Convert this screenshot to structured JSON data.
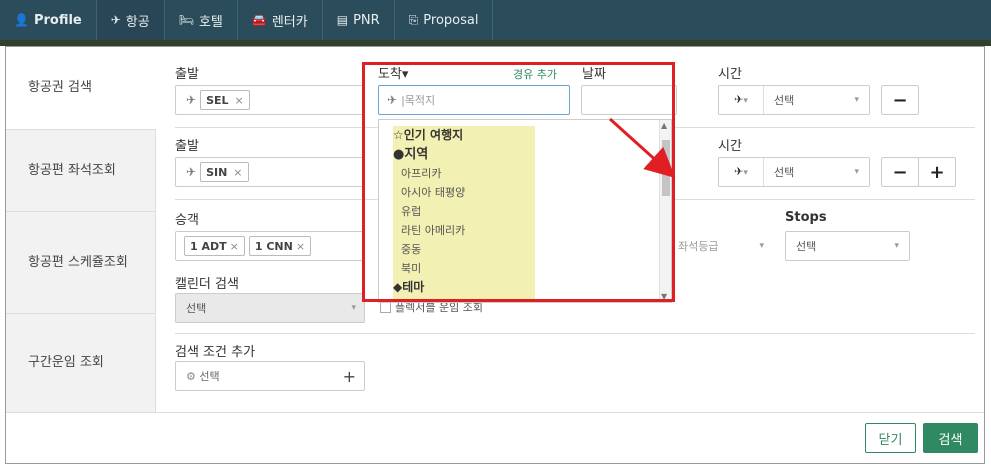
{
  "nav": {
    "tabs": [
      {
        "icon": "👤",
        "label": "Profile"
      },
      {
        "icon": "✈",
        "label": "항공"
      },
      {
        "icon": "🛏",
        "label": "호텔"
      },
      {
        "icon": "🚘",
        "label": "렌터카"
      },
      {
        "icon": "▤",
        "label": "PNR"
      },
      {
        "icon": "⎘",
        "label": "Proposal"
      }
    ]
  },
  "sidebar": {
    "items": [
      "항공권 검색",
      "항공편 좌석조회",
      "항공편 스케쥴조회",
      "구간운임 조회"
    ]
  },
  "form": {
    "row1": {
      "depart_label": "출발",
      "depart_chip": "SEL",
      "arrive_label": "도착▾",
      "add_stopover": "경유 추가",
      "arrive_placeholder": "목적지",
      "date_label": "날짜",
      "time_label": "시간",
      "time_select": "선택",
      "minus": "−"
    },
    "row2": {
      "depart_label": "출발",
      "depart_chip": "SIN",
      "time_label": "시간",
      "time_select": "선택",
      "minus": "−",
      "plus": "+"
    },
    "row3": {
      "pax_label": "승객",
      "pax_chips": [
        "1 ADT",
        "1 CNN"
      ],
      "seat_class": "좌석등급",
      "stops_label": "Stops",
      "stops_select": "선택",
      "calendar_label": "캘린더 검색",
      "calendar_select": "선택",
      "checkbox_label": "플렉서블 운임 조회"
    },
    "row4": {
      "add_cond_label": "검색 조건 추가",
      "add_cond_select": "선택",
      "add_plus": "+"
    }
  },
  "dropdown": {
    "popular": "인기 여행지",
    "region": "지역",
    "regions": [
      "아프리카",
      "아시아 태평양",
      "유럽",
      "라틴 아메리카",
      "중동",
      "북미"
    ],
    "theme": "테마"
  },
  "footer": {
    "close": "닫기",
    "search": "검색"
  },
  "colors": {
    "nav_bg": "#2b4c5a",
    "accent_green": "#2f8a63",
    "highlight": "#e01f24",
    "dropdown_highlight": "#f3f0b3"
  }
}
